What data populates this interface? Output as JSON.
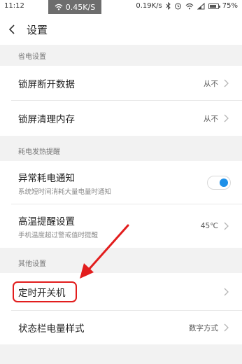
{
  "status_bar": {
    "time": "11:12",
    "net_speed": "0.45K/S",
    "right_speed": "0.19K/s",
    "battery": "75%",
    "battery_level": 0.75
  },
  "header": {
    "title": "设置"
  },
  "sections": {
    "power_saving": {
      "header": "省电设置",
      "lock_data": {
        "title": "锁屏断开数据",
        "value": "从不"
      },
      "lock_memory": {
        "title": "锁屏清理内存",
        "value": "从不"
      }
    },
    "heat": {
      "header": "耗电发热提醒",
      "abnormal": {
        "title": "异常耗电通知",
        "subtitle": "系统短时间消耗大量电量时通知",
        "toggle_on": true
      },
      "high_temp": {
        "title": "高温提醒设置",
        "subtitle": "手机温度超过警戒值时提醒",
        "value": "45℃"
      }
    },
    "other": {
      "header": "其他设置",
      "schedule": {
        "title": "定时开关机"
      },
      "statusbar_style": {
        "title": "状态栏电量样式",
        "value": "数字方式"
      }
    }
  },
  "colors": {
    "accent": "#1e90e8",
    "annotation": "#e21d1d"
  }
}
